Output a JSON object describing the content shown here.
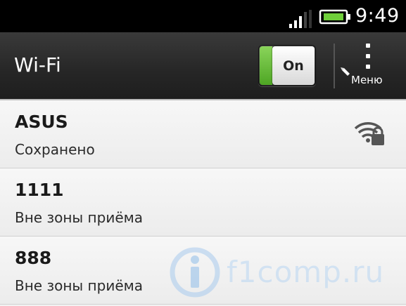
{
  "status_bar": {
    "time": "9:49",
    "signal_icon": "signal-bars-icon",
    "battery_icon": "battery-icon"
  },
  "action_bar": {
    "title": "Wi-Fi",
    "toggle_label": "On",
    "toggle_accent": "#5cb82f",
    "menu_label": "Меню",
    "menu_icon": "overflow-menu-icon"
  },
  "networks": [
    {
      "name": "ASUS",
      "status": "Сохранено",
      "icon": "wifi-locked-icon"
    },
    {
      "name": "1111",
      "status": "Вне зоны приёма"
    },
    {
      "name": "888",
      "status": "Вне зоны приёма"
    }
  ],
  "watermark": {
    "text": "f1comp.ru"
  }
}
